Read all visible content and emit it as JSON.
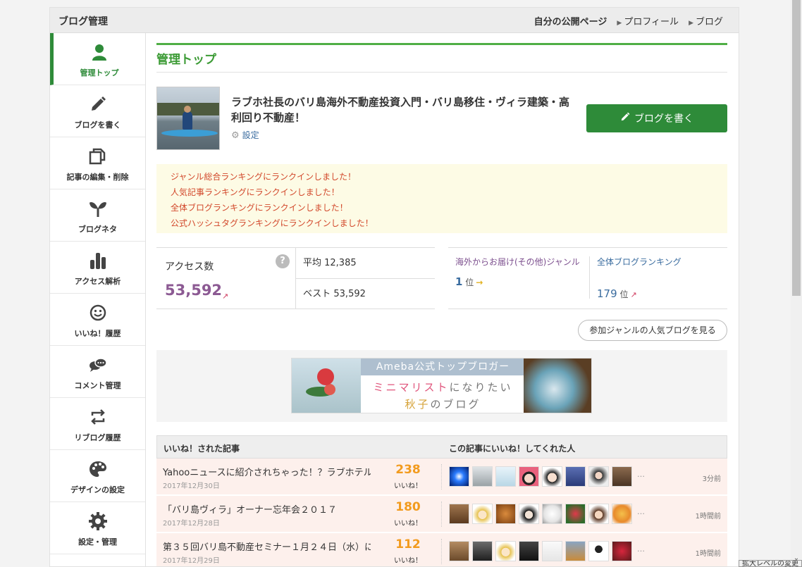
{
  "topbar": {
    "title": "ブログ管理",
    "links": [
      "自分の公開ページ",
      "プロフィール",
      "ブログ"
    ]
  },
  "sidebar": {
    "items": [
      {
        "label": "管理トップ",
        "icon": "person-icon"
      },
      {
        "label": "ブログを書く",
        "icon": "pencil-icon"
      },
      {
        "label": "記事の編集・削除",
        "icon": "documents-icon"
      },
      {
        "label": "ブログネタ",
        "icon": "sprout-icon"
      },
      {
        "label": "アクセス解析",
        "icon": "bar-chart-icon"
      },
      {
        "label": "いいね！履歴",
        "icon": "smile-icon"
      },
      {
        "label": "コメント管理",
        "icon": "comment-icon"
      },
      {
        "label": "リブログ履歴",
        "icon": "reblog-icon"
      },
      {
        "label": "デザインの設定",
        "icon": "palette-icon"
      },
      {
        "label": "設定・管理",
        "icon": "gear-icon"
      }
    ],
    "active_color": "#2e8b39"
  },
  "main": {
    "page_title": "管理トップ",
    "blog_title": "ラブホ社長のバリ島海外不動産投資入門・バリ島移住・ヴィラ建築・高利回り不動産！",
    "settings_label": "設定",
    "write_button_label": "ブログを書く",
    "notices": [
      "ジャンル総合ランキングにランクインしました！",
      "人気記事ランキングにランクインしました！",
      "全体ブログランキングにランクインしました！",
      "公式ハッシュタグランキングにランクインしました！"
    ],
    "access": {
      "title": "アクセス数",
      "help": "?",
      "count": "53,592",
      "average": "平均 12,385",
      "best": "ベスト 53,592"
    },
    "ranking": {
      "genre_label": "海外からお届け(その他)ジャンル",
      "genre_rank": "1",
      "overall_label": "全体ブログランキング",
      "overall_rank": "179",
      "unit": "位"
    },
    "popular_button": "参加ジャンルの人気ブログを見る",
    "banner": {
      "header": "Ameba公式トップブロガー",
      "line1_accent": "ミニマリスト",
      "line1_rest": "になりたい",
      "line2_accent": "秋子",
      "line2_rest": "のブログ"
    },
    "likes": {
      "col1": "いいね！された記事",
      "col2": "この記事にいいね！してくれた人",
      "count_label": "いいね！",
      "more": "…",
      "rows": [
        {
          "title": "Yahooニュースに紹介されちゃった！？ラブホテル…",
          "date": "2017年12月30日",
          "count": "238",
          "time": "3分前"
        },
        {
          "title": "「バリ島ヴィラ」オーナー忘年会２０１７",
          "date": "2017年12月28日",
          "count": "180",
          "time": "1時間前"
        },
        {
          "title": "第３５回バリ島不動産セミナー１月２４日（水）に…",
          "date": "2017年12月29日",
          "count": "112",
          "time": "1時間前"
        }
      ]
    }
  },
  "browser": {
    "zoom_label": "拡大レベルの変更"
  }
}
